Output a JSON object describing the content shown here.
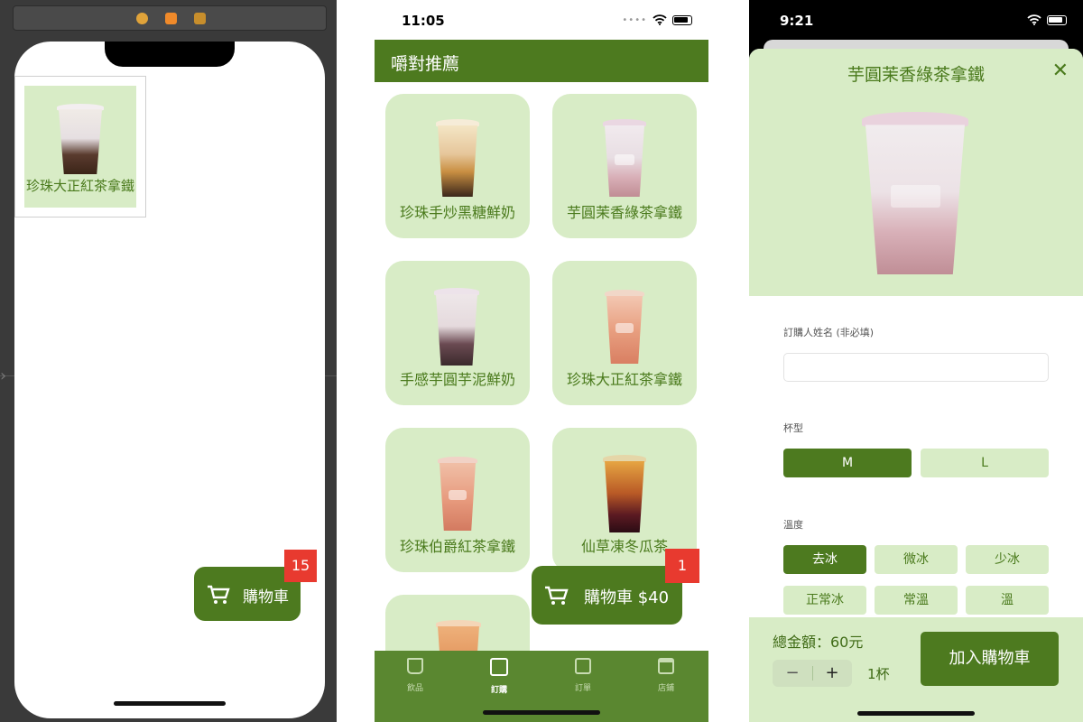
{
  "storyboard": {
    "cell_label": "珍珠大正紅茶拿鐵",
    "cart_label": "購物車",
    "cart_badge": "15"
  },
  "menu_screen": {
    "status_time": "11:05",
    "nav_title": "嚼對推薦",
    "items": [
      {
        "label": "珍珠手炒黑糖鮮奶"
      },
      {
        "label": "芋圓茉香綠茶拿鐵"
      },
      {
        "label": "手感芋圓芋泥鮮奶"
      },
      {
        "label": "珍珠大正紅茶拿鐵"
      },
      {
        "label": "珍珠伯爵紅茶拿鐵"
      },
      {
        "label": "仙草凍冬瓜茶"
      },
      {
        "label": ""
      }
    ],
    "cart_label": "購物車 $40",
    "cart_badge": "1",
    "tabs": [
      {
        "label": "飲品",
        "icon": "cup-icon"
      },
      {
        "label": "訂購",
        "icon": "bag-icon"
      },
      {
        "label": "訂單",
        "icon": "list-icon"
      },
      {
        "label": "店鋪",
        "icon": "store-icon"
      }
    ],
    "active_tab": "訂購"
  },
  "detail_screen": {
    "status_time": "9:21",
    "title": "芋圓茉香綠茶拿鐵",
    "close_glyph": "✕",
    "name_label": "訂購人姓名 (非必填)",
    "name_value": "",
    "size_label": "杯型",
    "sizes": [
      "M",
      "L"
    ],
    "selected_size": "M",
    "temp_label": "溫度",
    "temps": [
      "去冰",
      "微冰",
      "少冰",
      "正常冰",
      "常溫",
      "溫"
    ],
    "selected_temp": "去冰",
    "total": "總金額：60元",
    "minus": "−",
    "plus": "+",
    "quantity": "1杯",
    "add_button": "加入購物車"
  },
  "colors": {
    "brand_green": "#4d7a1f",
    "light_green": "#d8ecc6",
    "badge_red": "#e83a2f"
  }
}
